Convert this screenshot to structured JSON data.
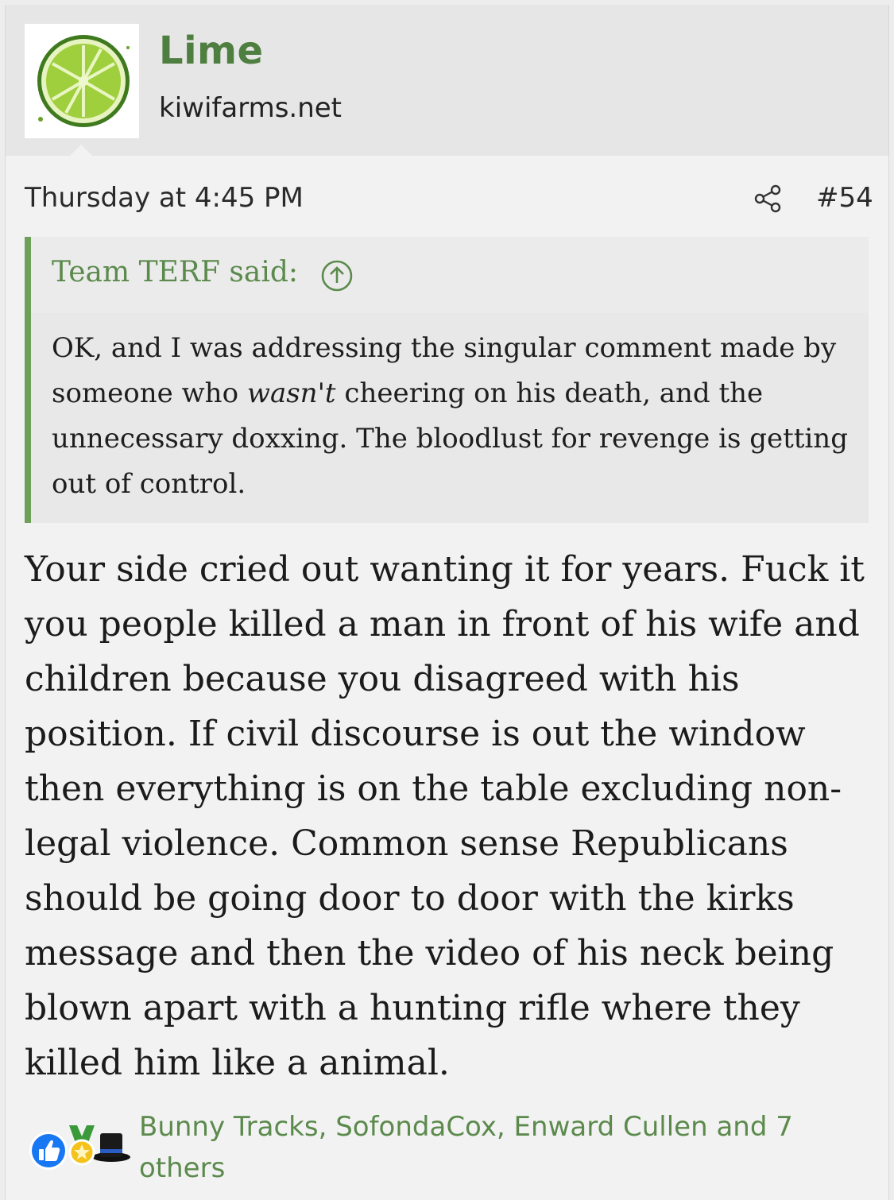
{
  "header": {
    "username": "Lime",
    "site": "kiwifarms.net"
  },
  "post": {
    "timestamp": "Thursday at 4:45 PM",
    "number": "#54",
    "quote": {
      "author_label": "Team TERF said:",
      "text_before": "OK, and I was addressing the singular comment made by someone who ",
      "text_em": "wasn't",
      "text_after": " cheering on his death, and the unnecessary doxxing. The bloodlust for revenge is getting out of control."
    },
    "body": "Your side cried out wanting it for years. Fuck it you people killed a man in front of his wife and children because you disagreed with his position. If civil discourse is out the window then everything is on the table excluding non-legal violence. Common sense Republicans should be going door to door with the kirks message and then the video of his neck being blown apart with a hunting rifle where they killed him like a animal.",
    "reactions": {
      "icons": [
        "thumbs-up-icon",
        "medal-icon",
        "top-hat-icon"
      ],
      "names_text": "Bunny Tracks, SofondaCox, Enward Cullen and 7 others"
    }
  },
  "colors": {
    "accent_green": "#5b8a4c",
    "quote_bar": "#6ea05a",
    "username_green": "#4f7f40"
  },
  "icons": {
    "avatar": "lime-slice-avatar",
    "share": "share-icon",
    "quote_jump": "arrow-up-circle-icon"
  }
}
